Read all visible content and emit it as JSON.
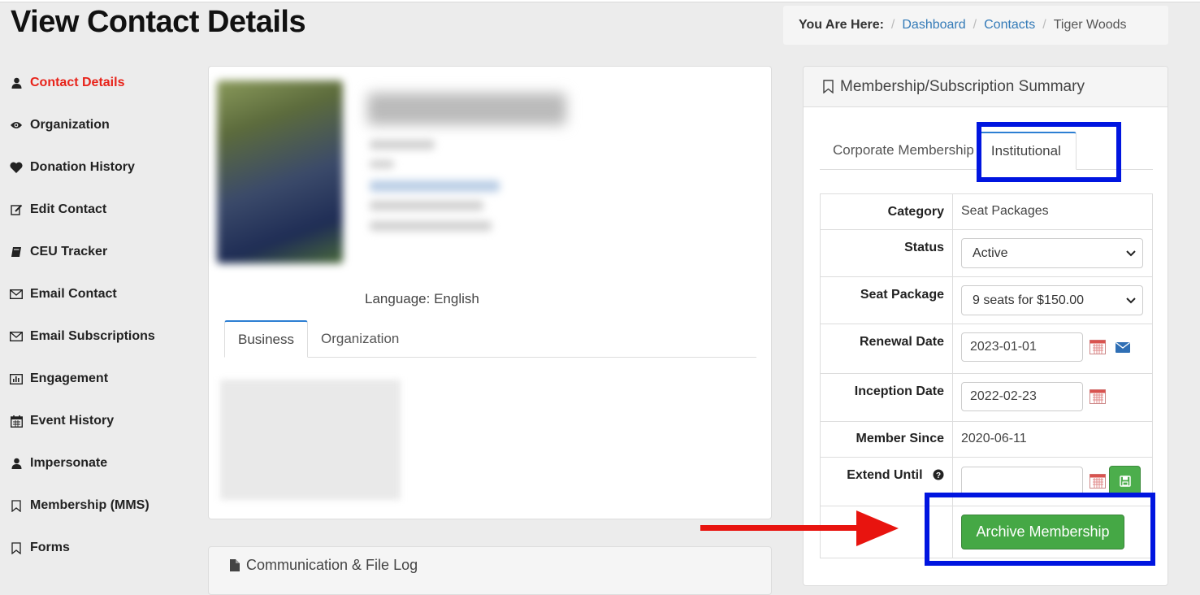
{
  "page": {
    "title": "View Contact Details"
  },
  "breadcrumb": {
    "label": "You Are Here:",
    "items": [
      "Dashboard",
      "Contacts"
    ],
    "current": "Tiger Woods"
  },
  "sidebar": {
    "items": [
      {
        "label": "Contact Details",
        "icon": "user-icon",
        "active": true
      },
      {
        "label": "Organization",
        "icon": "eye-icon"
      },
      {
        "label": "Donation History",
        "icon": "heart-icon"
      },
      {
        "label": "Edit Contact",
        "icon": "edit-icon"
      },
      {
        "label": "CEU Tracker",
        "icon": "book-icon"
      },
      {
        "label": "Email Contact",
        "icon": "envelope-icon"
      },
      {
        "label": "Email Subscriptions",
        "icon": "envelope-icon"
      },
      {
        "label": "Engagement",
        "icon": "bar-chart-icon"
      },
      {
        "label": "Event History",
        "icon": "calendar-icon"
      },
      {
        "label": "Impersonate",
        "icon": "user-icon"
      },
      {
        "label": "Membership (MMS)",
        "icon": "bookmark-icon"
      },
      {
        "label": "Forms",
        "icon": "bookmark-icon"
      }
    ]
  },
  "contact": {
    "language": "Language: English",
    "tabs": [
      "Business",
      "Organization"
    ]
  },
  "communication": {
    "title": "Communication & File Log"
  },
  "summary": {
    "title": "Membership/Subscription Summary",
    "tabs": [
      "Corporate Membership",
      "Institutional"
    ],
    "labels": {
      "category": "Category",
      "status": "Status",
      "seat_package": "Seat Package",
      "renewal_date": "Renewal Date",
      "inception_date": "Inception Date",
      "member_since": "Member Since",
      "extend_until": "Extend Until"
    },
    "values": {
      "category": "Seat Packages",
      "status": "Active",
      "seat_package": "9 seats for $150.00",
      "renewal_date": "2023-01-01",
      "inception_date": "2022-02-23",
      "member_since": "2020-06-11",
      "extend_until": ""
    },
    "archive_button": "Archive Membership"
  },
  "colors": {
    "active_nav": "#e8231a",
    "link": "#337ab7",
    "success": "#45a845",
    "highlight": "#0015e0",
    "arrow": "#e8140f"
  }
}
